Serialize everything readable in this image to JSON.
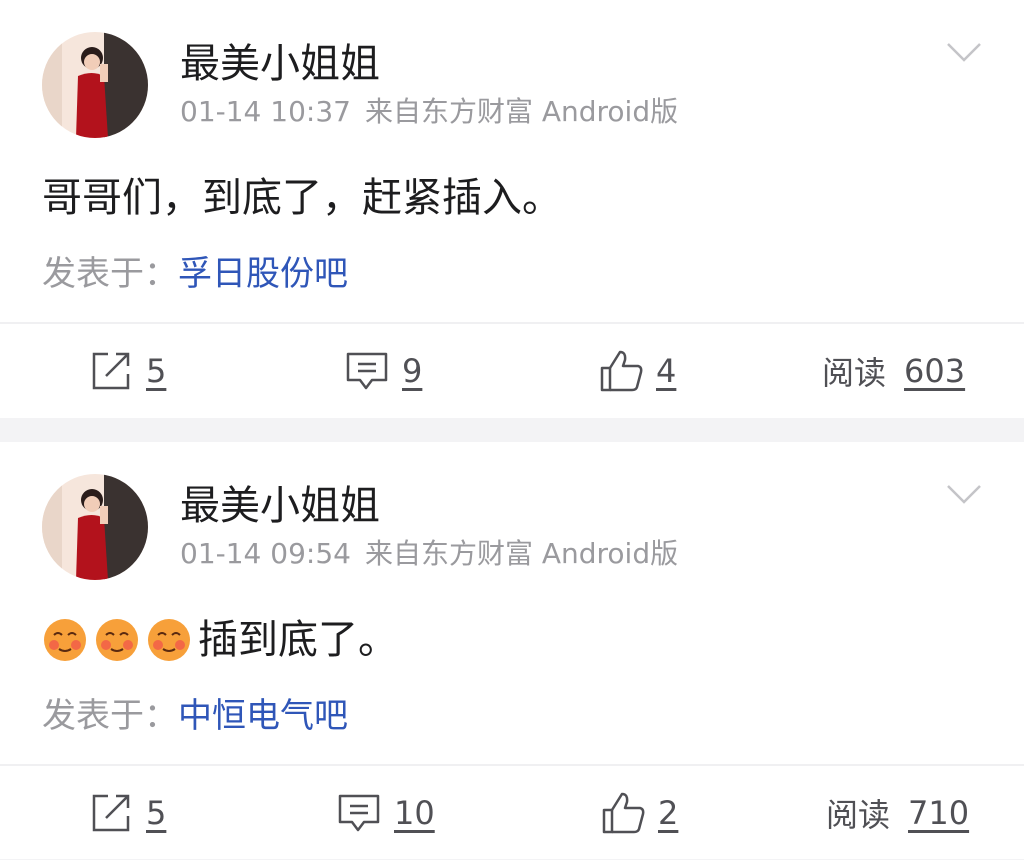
{
  "posts": [
    {
      "author": "最美小姐姐",
      "date": "01-14 10:37",
      "source_client": "来自东方财富 Android版",
      "content": "哥哥们，到底了，赶紧插入。",
      "emoji_count": 0,
      "posted_in_label": "发表于：",
      "posted_in": "孚日股份吧",
      "share_count": "5",
      "comment_count": "9",
      "like_count": "4",
      "read_label": "阅读",
      "read_count": "603"
    },
    {
      "author": "最美小姐姐",
      "date": "01-14 09:54",
      "source_client": "来自东方财富 Android版",
      "content": "插到底了。",
      "emoji_count": 3,
      "posted_in_label": "发表于：",
      "posted_in": "中恒电气吧",
      "share_count": "5",
      "comment_count": "10",
      "like_count": "2",
      "read_label": "阅读",
      "read_count": "710"
    }
  ],
  "colors": {
    "text_primary": "#1d1d1f",
    "text_secondary": "#9a9a9e",
    "link_blue": "#2f56b8",
    "page_bg": "#f3f3f5"
  },
  "icons": [
    "avatar-photo",
    "chevron-down-icon",
    "share-icon",
    "comment-icon",
    "thumbs-up-icon",
    "blush-emoji"
  ]
}
